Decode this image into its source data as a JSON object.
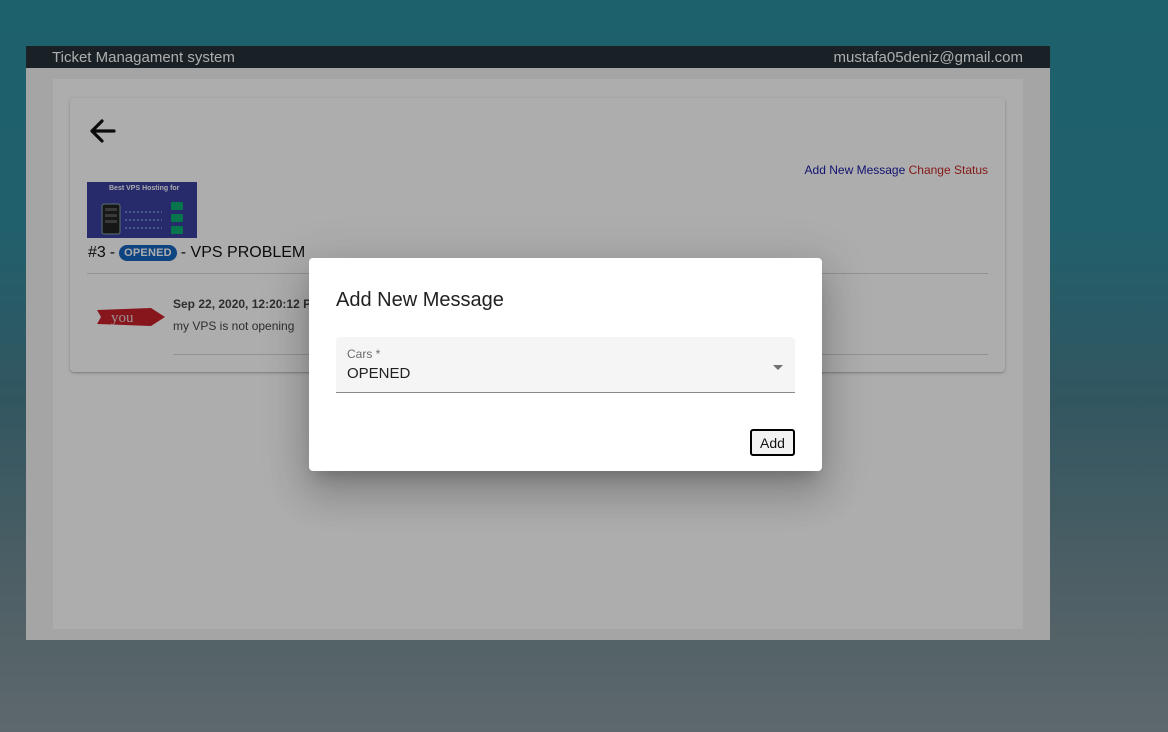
{
  "header": {
    "app_title": "Ticket Managament system",
    "user_email": "mustafa05deniz@gmail.com"
  },
  "ticket": {
    "actions": {
      "add_message": "Add New Message",
      "change_status": "Change Status"
    },
    "thumbnail": {
      "title": "Best VPS Hosting for"
    },
    "number": "#3",
    "separator": "-",
    "status": "OPENED",
    "subject": "- VPS PROBLEM",
    "messages": [
      {
        "author_badge": "you",
        "time": "Sep 22, 2020, 12:20:12 P",
        "text": "my VPS is not opening"
      }
    ]
  },
  "dialog": {
    "title": "Add New Message",
    "select_label": "Cars *",
    "select_value": "OPENED",
    "add_label": "Add"
  },
  "colors": {
    "topbar": "#263238",
    "badge": "#1565c0",
    "link_add": "#1a1aa6",
    "link_status": "#c62828",
    "you_arrow": "#c8202a"
  }
}
